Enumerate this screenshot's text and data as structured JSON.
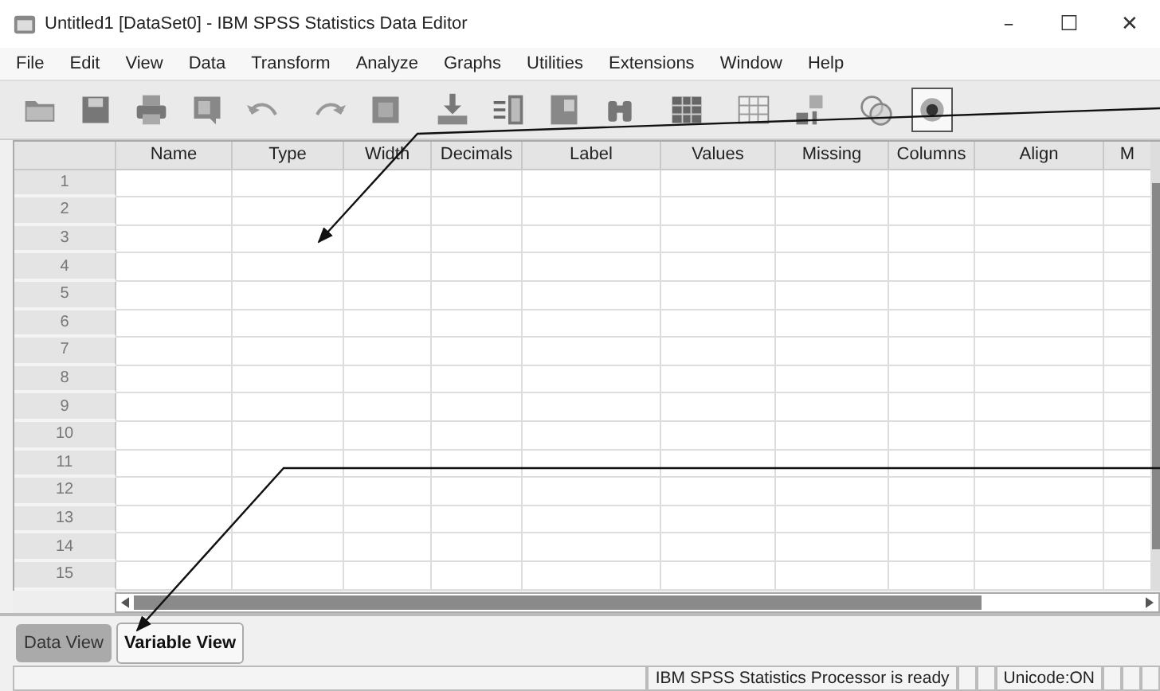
{
  "window": {
    "title": "Untitled1 [DataSet0] - IBM SPSS Statistics Data Editor",
    "controls": [
      "–",
      "☐",
      "✕"
    ]
  },
  "menu": [
    "File",
    "Edit",
    "View",
    "Data",
    "Transform",
    "Analyze",
    "Graphs",
    "Utilities",
    "Extensions",
    "Window",
    "Help"
  ],
  "grid": {
    "columns": [
      "Name",
      "Type",
      "Width",
      "Decimals",
      "Label",
      "Values",
      "Missing",
      "Columns",
      "Align",
      "M"
    ],
    "rows": [
      "1",
      "2",
      "3",
      "4",
      "5",
      "6",
      "7",
      "8",
      "9",
      "10",
      "11",
      "12",
      "13",
      "14",
      "15"
    ]
  },
  "tabs": [
    {
      "label": "Data View",
      "selected": false
    },
    {
      "label": "Variable View",
      "selected": true
    }
  ],
  "status_bar": {
    "message": "IBM SPSS Statistics Processor is ready",
    "encoding": "Unicode:ON"
  }
}
